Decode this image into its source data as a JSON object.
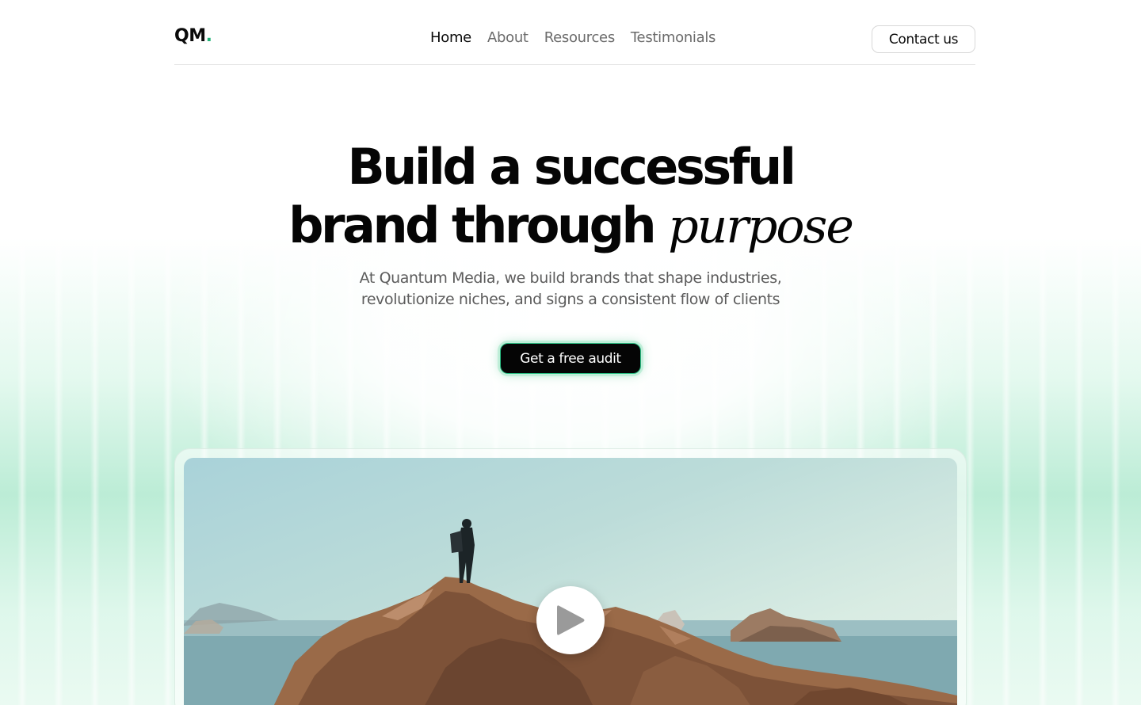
{
  "header": {
    "logo_text": "QM",
    "logo_dot": ".",
    "nav": [
      {
        "label": "Home",
        "active": true
      },
      {
        "label": "About",
        "active": false
      },
      {
        "label": "Resources",
        "active": false
      },
      {
        "label": "Testimonials",
        "active": false
      }
    ],
    "contact_label": "Contact us"
  },
  "hero": {
    "title_line1": "Build a successful",
    "title_line2": "brand through",
    "title_accent": "purpose",
    "subtitle_line1": "At Quantum Media, we build brands that shape industries,",
    "subtitle_line2": "revolutionize niches, and signs a consistent flow of clients",
    "cta_label": "Get a free audit"
  },
  "video": {
    "play_icon": "play-icon",
    "image_subject": "hiker-on-coastal-rocks"
  },
  "colors": {
    "accent": "#22b378",
    "cta_bg": "#050505",
    "glow": "#a5e6c8",
    "text_muted": "#6b6b6b"
  }
}
